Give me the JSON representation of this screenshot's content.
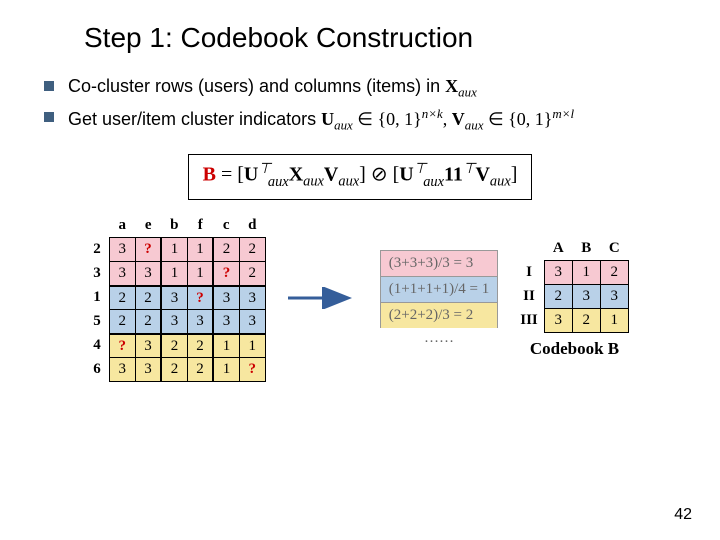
{
  "title": "Step 1: Codebook Construction",
  "bullets": {
    "b1_pre": "Co-cluster rows (users) and columns (items) in ",
    "b1_sym": "X",
    "b1_sub": "aux",
    "b2_pre": "Get user/item cluster indicators ",
    "b2_U": "U",
    "b2_Uaux": "aux",
    "b2_in1": " ∈ {0, 1}",
    "b2_nk": "n×k",
    "b2_comma": ", ",
    "b2_V": "V",
    "b2_Vaux": "aux",
    "b2_in2": " ∈ {0, 1}",
    "b2_ml": "m×l"
  },
  "formula": {
    "B": "B",
    "eq": " = [",
    "Ut": "U",
    "Ut_sup": "⊤",
    "aux": "aux",
    "X": "X",
    "V": "V",
    "mid": "] ⊘ [",
    "ones": "11",
    "ones_sup": "⊤",
    "close": "]"
  },
  "left_table": {
    "col_headers": [
      "a",
      "e",
      "b",
      "f",
      "c",
      "d"
    ],
    "row_headers": [
      "2",
      "3",
      "1",
      "5",
      "4",
      "6"
    ],
    "cells": [
      [
        "3",
        "?",
        "1",
        "1",
        "2",
        "2"
      ],
      [
        "3",
        "3",
        "1",
        "1",
        "?",
        "2"
      ],
      [
        "2",
        "2",
        "3",
        "?",
        "3",
        "3"
      ],
      [
        "2",
        "2",
        "3",
        "3",
        "3",
        "3"
      ],
      [
        "?",
        "3",
        "2",
        "2",
        "1",
        "1"
      ],
      [
        "3",
        "3",
        "2",
        "2",
        "1",
        "?"
      ]
    ],
    "row_bg": [
      "bg-pink",
      "bg-pink",
      "bg-blue",
      "bg-blue",
      "bg-yellow",
      "bg-yellow"
    ]
  },
  "mid_eq": {
    "r1": "(3+3+3)/3 = 3",
    "r2": "(1+1+1+1)/4 = 1",
    "r3": "(2+2+2)/3 = 2",
    "dots": "……"
  },
  "right_table": {
    "col_headers": [
      "A",
      "B",
      "C"
    ],
    "row_headers": [
      "I",
      "II",
      "III"
    ],
    "cells": [
      [
        "3",
        "1",
        "2"
      ],
      [
        "2",
        "3",
        "3"
      ],
      [
        "3",
        "2",
        "1"
      ]
    ],
    "row_bg": [
      "bg-pink",
      "bg-blue",
      "bg-yellow"
    ],
    "label": "Codebook B"
  },
  "page_number": "42"
}
